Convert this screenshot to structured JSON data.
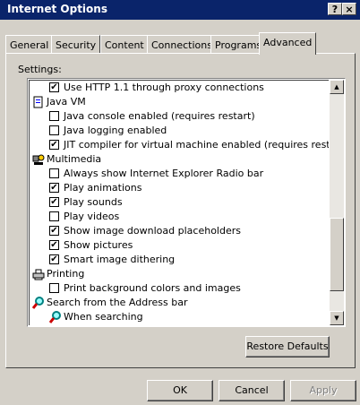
{
  "window": {
    "title": "Internet Options",
    "help_label": "?",
    "close_label": "×"
  },
  "tabs": [
    {
      "label": "General"
    },
    {
      "label": "Security"
    },
    {
      "label": "Content"
    },
    {
      "label": "Connections"
    },
    {
      "label": "Programs"
    },
    {
      "label": "Advanced",
      "active": true
    }
  ],
  "settings_label": "Settings:",
  "tree": [
    {
      "type": "option",
      "checked": true,
      "text": "Use HTTP 1.1 through proxy connections"
    },
    {
      "type": "category",
      "icon": "document-icon",
      "text": "Java VM"
    },
    {
      "type": "option",
      "checked": false,
      "text": "Java console enabled (requires restart)"
    },
    {
      "type": "option",
      "checked": false,
      "text": "Java logging enabled"
    },
    {
      "type": "option",
      "checked": true,
      "text": "JIT compiler for virtual machine enabled (requires restart)"
    },
    {
      "type": "category",
      "icon": "multimedia-icon",
      "text": "Multimedia"
    },
    {
      "type": "option",
      "checked": false,
      "text": "Always show Internet Explorer Radio bar"
    },
    {
      "type": "option",
      "checked": true,
      "text": "Play animations"
    },
    {
      "type": "option",
      "checked": true,
      "text": "Play sounds"
    },
    {
      "type": "option",
      "checked": false,
      "text": "Play videos"
    },
    {
      "type": "option",
      "checked": true,
      "text": "Show image download placeholders"
    },
    {
      "type": "option",
      "checked": true,
      "text": "Show pictures"
    },
    {
      "type": "option",
      "checked": true,
      "text": "Smart image dithering"
    },
    {
      "type": "category",
      "icon": "printer-icon",
      "text": "Printing"
    },
    {
      "type": "option",
      "checked": false,
      "text": "Print background colors and images"
    },
    {
      "type": "category",
      "icon": "search-icon",
      "text": "Search from the Address bar"
    },
    {
      "type": "subitem",
      "icon": "search-icon",
      "text": "When searching"
    }
  ],
  "buttons": {
    "restore_defaults": "Restore Defaults",
    "ok": "OK",
    "cancel": "Cancel",
    "apply": "Apply"
  },
  "colors": {
    "title_bar": "#0a246a",
    "face": "#d4d0c8"
  }
}
